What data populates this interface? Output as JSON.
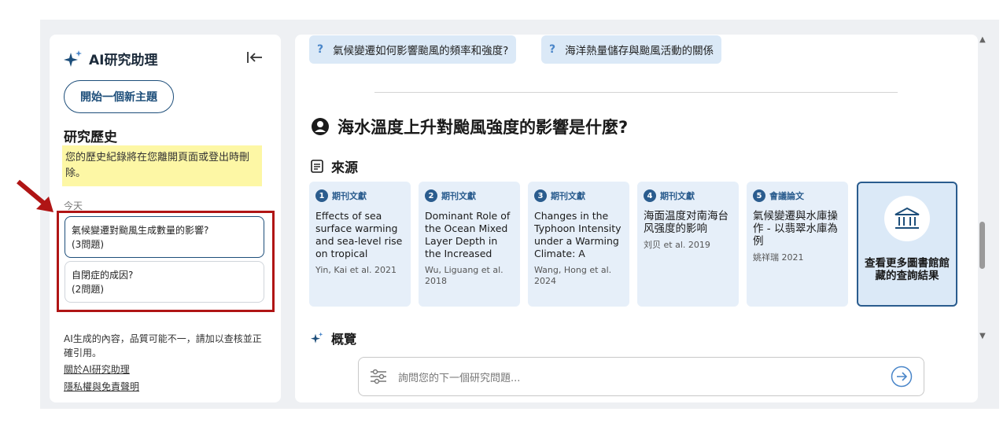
{
  "sidebar": {
    "title": "AI研究助理",
    "new_topic": "開始一個新主題",
    "history_heading": "研究歷史",
    "notice": "您的歷史紀錄將在您離開頁面或登出時刪除。",
    "today": "今天",
    "items": [
      {
        "title": "氣候變遷對颱風生成數量的影響?",
        "count": "(3問題)"
      },
      {
        "title": "自閉症的成因?",
        "count": "(2問題)"
      }
    ],
    "disclaimer": "AI生成的內容，品質可能不一，請加以查核並正確引用。",
    "link_about": "關於AI研究助理",
    "link_privacy": "隱私權與免責聲明"
  },
  "main": {
    "chips": [
      "氣候變遷如何影響颱風的頻率和強度?",
      "海洋熱量儲存與颱風活動的關係"
    ],
    "question": "海水溫度上升對颱風強度的影響是什麼?",
    "sources_heading": "來源",
    "sources": [
      {
        "num": "1",
        "type": "期刊文獻",
        "title": "Effects of sea surface warming and sea-level rise on tropical cyclone and…",
        "author": "Yin, Kai et al. 2021"
      },
      {
        "num": "2",
        "type": "期刊文獻",
        "title": "Dominant Role of the Ocean Mixed Layer Depth in the Increased Proportion of…",
        "author": "Wu, Liguang et al. 2018"
      },
      {
        "num": "3",
        "type": "期刊文獻",
        "title": "Changes in the Typhoon Intensity under a Warming Climate: A Numerical Study…",
        "author": "Wang, Hong et al. 2024"
      },
      {
        "num": "4",
        "type": "期刊文獻",
        "title": "海面温度对南海台风强度的影响",
        "author": "刘贝 et al. 2019"
      },
      {
        "num": "5",
        "type": "會議論文",
        "title": "氣候變遷與水庫操作 - 以翡翠水庫為例",
        "author": "姚祥瑞 2021"
      }
    ],
    "more_results": "查看更多圖書館館藏的查詢結果",
    "overview_heading": "概覽",
    "ask_placeholder": "詢問您的下一個研究問題..."
  },
  "colors": {
    "accent": "#1d4e7a",
    "highlight": "#fdf7a5",
    "annotation": "#b01515",
    "chip": "#dbe9f7"
  }
}
